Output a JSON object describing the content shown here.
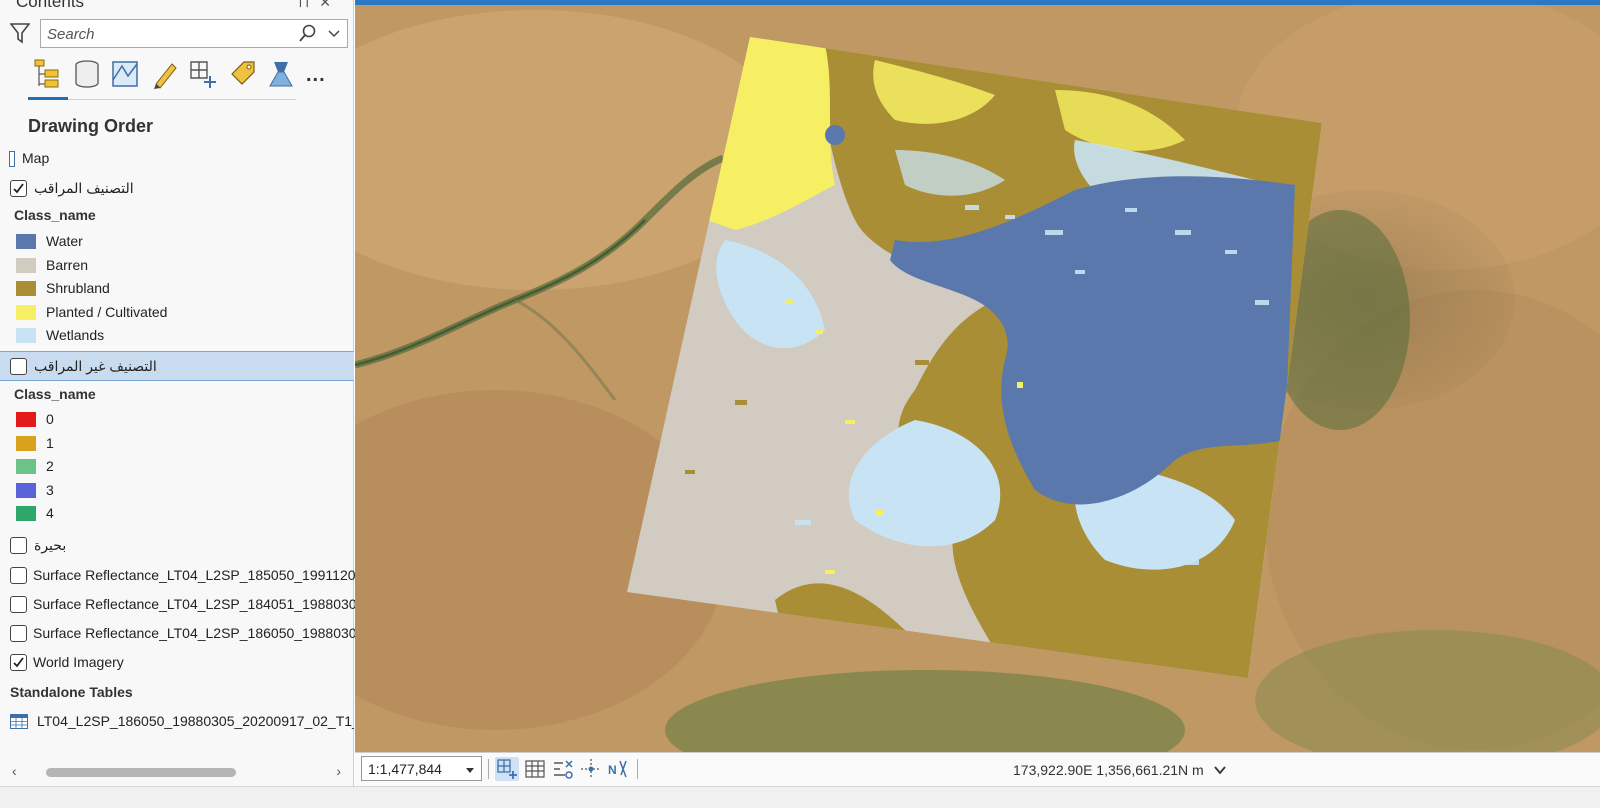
{
  "pane": {
    "title": "Contents",
    "search_placeholder": "Search",
    "section_title": "Drawing Order",
    "map_label": "Map",
    "layers": {
      "supervised": {
        "name": "التصنيف المراقب",
        "checked": true
      },
      "supervised_header": "Class_name",
      "supervised_classes": [
        {
          "label": "Water",
          "color": "#5a78ab"
        },
        {
          "label": "Barren",
          "color": "#d2cbc2"
        },
        {
          "label": "Shrubland",
          "color": "#a98e36"
        },
        {
          "label": "Planted / Cultivated",
          "color": "#f6ef63"
        },
        {
          "label": "Wetlands",
          "color": "#c8e3f3"
        }
      ],
      "unsupervised": {
        "name": "التصنيف غير المراقب",
        "checked": false
      },
      "unsupervised_header": "Class_name",
      "unsupervised_classes": [
        {
          "label": "0",
          "color": "#e31a1c"
        },
        {
          "label": "1",
          "color": "#d9a21a"
        },
        {
          "label": "2",
          "color": "#6cc38a"
        },
        {
          "label": "3",
          "color": "#5b63d8"
        },
        {
          "label": "4",
          "color": "#2fa66a"
        }
      ],
      "lake": {
        "name": "بحيرة",
        "checked": false
      },
      "sr1": {
        "name": "Surface Reflectance_LT04_L2SP_185050_1991120",
        "checked": false
      },
      "sr2": {
        "name": "Surface Reflectance_LT04_L2SP_184051_1988030",
        "checked": false
      },
      "sr3": {
        "name": "Surface Reflectance_LT04_L2SP_186050_1988030",
        "checked": false
      },
      "world_imagery": {
        "name": "World Imagery",
        "checked": true
      }
    },
    "standalone_title": "Standalone Tables",
    "table_name": "LT04_L2SP_186050_19880305_20200917_02_T1_",
    "scroll_left": "‹",
    "scroll_right": "›",
    "more": "..."
  },
  "status": {
    "scale": "1:1,477,844",
    "coordinates": "173,922.90E 1,356,661.21N m"
  },
  "colors": {
    "accent": "#1f6fbf",
    "selection": "#c9dcef"
  }
}
